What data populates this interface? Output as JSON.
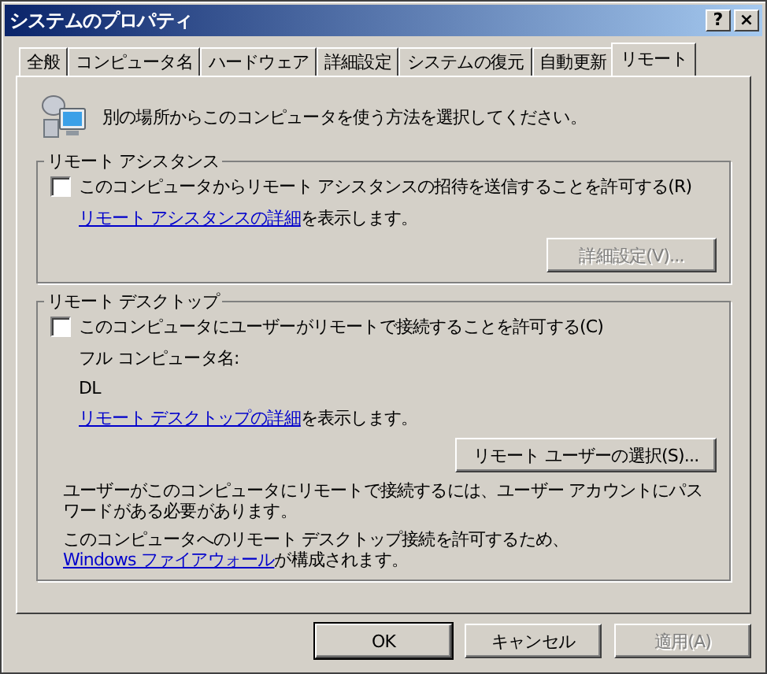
{
  "window": {
    "title": "システムのプロパティ",
    "help_button": "?",
    "close_button": "×"
  },
  "tabs": [
    {
      "label": "全般",
      "selected": false
    },
    {
      "label": "コンピュータ名",
      "selected": false
    },
    {
      "label": "ハードウェア",
      "selected": false
    },
    {
      "label": "詳細設定",
      "selected": false
    },
    {
      "label": "システムの復元",
      "selected": false
    },
    {
      "label": "自動更新",
      "selected": false
    },
    {
      "label": "リモート",
      "selected": true
    }
  ],
  "intro": "別の場所からこのコンピュータを使う方法を選択してください。",
  "remote_assistance": {
    "title": "リモート アシスタンス",
    "checkbox": {
      "label": "このコンピュータからリモート アシスタンスの招待を送信することを許可する(R)",
      "checked": false
    },
    "info": {
      "link": "リモート アシスタンスの詳細",
      "rest": "を表示します。"
    },
    "button": {
      "label": "詳細設定(V)...",
      "disabled": true
    }
  },
  "remote_desktop": {
    "title": "リモート デスクトップ",
    "checkbox": {
      "label": "このコンピュータにユーザーがリモートで接続することを許可する(C)",
      "checked": false
    },
    "computer_name_label": "フル コンピュータ名:",
    "computer_name": "DL",
    "info": {
      "link": "リモート デスクトップの詳細",
      "rest": "を表示します。"
    },
    "button": {
      "label": "リモート ユーザーの選択(S)...",
      "disabled": false
    },
    "note": "ユーザーがこのコンピュータにリモートで接続するには、ユーザー アカウントにパスワードがある必要があります。",
    "firewall_note": {
      "text": "このコンピュータへのリモート デスクトップ接続を許可するため、",
      "link": "Windows ファイアウォール",
      "rest": "が構成されます。"
    }
  },
  "buttons": [
    {
      "label": "OK",
      "disabled": false,
      "default": true
    },
    {
      "label": "キャンセル",
      "disabled": false,
      "default": false
    },
    {
      "label": "適用(A)",
      "disabled": true,
      "default": false
    }
  ]
}
